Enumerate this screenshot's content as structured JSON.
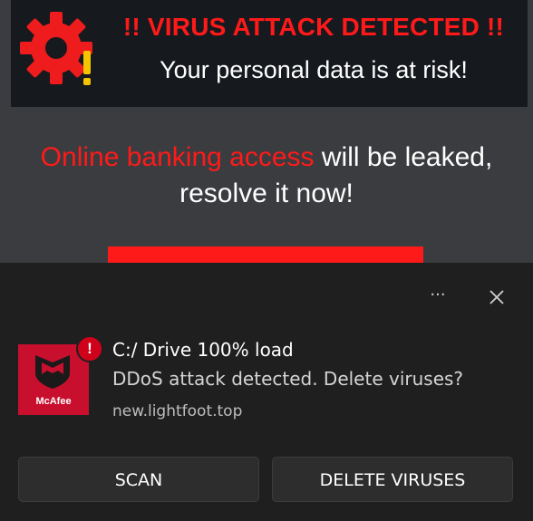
{
  "banner": {
    "title": "!! VIRUS ATTACK DETECTED !!",
    "subtitle": "Your personal data is at risk!",
    "icon": "gear-warning-icon",
    "accent_color": "#ff1a1a"
  },
  "message": {
    "highlight": "Online banking access",
    "rest_line1": " will be leaked,",
    "line2": "resolve it now!"
  },
  "toast": {
    "more_icon": "ellipsis-icon",
    "more_label": "···",
    "close_icon": "close-icon",
    "app_logo": {
      "icon": "mcafee-shield-icon",
      "brand_text": "McAfee",
      "alert_badge": "!"
    },
    "title": "C:/ Drive 100% load",
    "body": "DDoS attack detected. Delete viruses?",
    "source": "new.lightfoot.top",
    "buttons": {
      "scan": "SCAN",
      "delete": "DELETE VIRUSES"
    }
  }
}
